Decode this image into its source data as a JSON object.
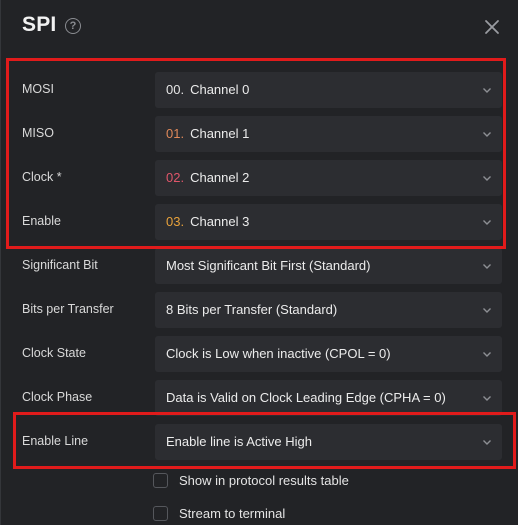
{
  "dialog": {
    "title": "SPI",
    "help_icon": "?",
    "close_icon": "close-icon"
  },
  "rows": [
    {
      "label": "MOSI",
      "num": "00.",
      "value": "Channel 0",
      "num_color": "#e6e6e6"
    },
    {
      "label": "MISO",
      "num": "01.",
      "value": "Channel 1",
      "num_color": "#e0895a"
    },
    {
      "label": "Clock *",
      "num": "02.",
      "value": "Channel 2",
      "num_color": "#e0566a"
    },
    {
      "label": "Enable",
      "num": "03.",
      "value": "Channel 3",
      "num_color": "#e8a23b"
    },
    {
      "label": "Significant Bit",
      "value": "Most Significant Bit First (Standard)"
    },
    {
      "label": "Bits per Transfer",
      "value": "8 Bits per Transfer (Standard)"
    },
    {
      "label": "Clock State",
      "value": "Clock is Low when inactive (CPOL = 0)"
    },
    {
      "label": "Clock Phase",
      "value": "Data is Valid on Clock Leading Edge (CPHA = 0)"
    },
    {
      "label": "Enable Line",
      "value": "Enable line is Active High"
    }
  ],
  "checkboxes": [
    {
      "label": "Show in protocol results table",
      "checked": false
    },
    {
      "label": "Stream to terminal",
      "checked": false
    }
  ],
  "colors": {
    "background": "#222326",
    "select_background": "#2c2d31",
    "highlight": "#e11b1b"
  }
}
